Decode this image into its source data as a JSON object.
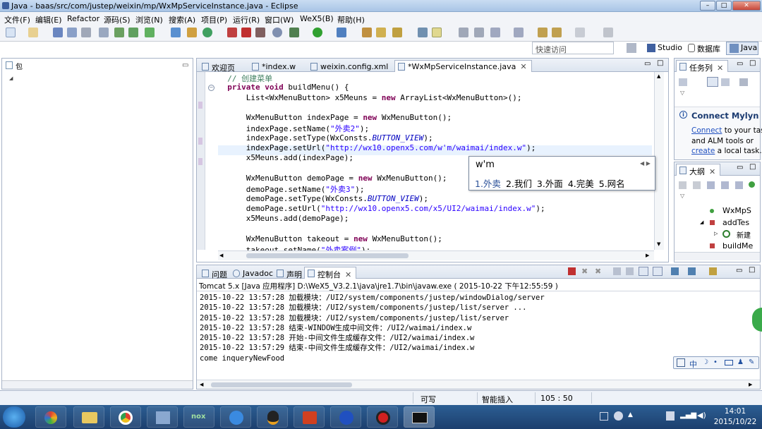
{
  "window": {
    "title": "Java - baas/src/com/justep/weixin/mp/WxMpServiceInstance.java - Eclipse"
  },
  "menu": [
    "文件(F)",
    "编辑(E)",
    "Refactor",
    "源码(S)",
    "浏览(N)",
    "搜索(A)",
    "项目(P)",
    "运行(R)",
    "窗口(W)",
    "WeX5(B)",
    "帮助(H)"
  ],
  "quick_access": {
    "placeholder": "快速访问"
  },
  "perspectives": [
    "Studio",
    "数据库",
    "Java"
  ],
  "left_panel": {
    "label": "包"
  },
  "editor_tabs": [
    "欢迎页",
    "*index.w",
    "weixin.config.xml",
    "*WxMpServiceInstance.java"
  ],
  "code_lines": [
    {
      "parts": [
        [
          "cm",
          "  // 创建菜单"
        ]
      ]
    },
    {
      "parts": [
        [
          "kw",
          "  private void "
        ],
        [
          "n",
          "buildMenu() {"
        ]
      ]
    },
    {
      "parts": [
        [
          "n",
          "      List<WxMenuButton> x5Meuns = "
        ],
        [
          "kw",
          "new "
        ],
        [
          "n",
          "ArrayList<WxMenuButton>();"
        ]
      ]
    },
    {
      "parts": [
        [
          "n",
          ""
        ]
      ]
    },
    {
      "parts": [
        [
          "n",
          "      WxMenuButton indexPage = "
        ],
        [
          "kw",
          "new "
        ],
        [
          "n",
          "WxMenuButton();"
        ]
      ]
    },
    {
      "parts": [
        [
          "n",
          "      indexPage.setName("
        ],
        [
          "str",
          "\"外卖2\""
        ],
        [
          "n",
          ");"
        ]
      ]
    },
    {
      "parts": [
        [
          "n",
          "      indexPage.setType(WxConsts."
        ],
        [
          "it",
          "BUTTON_VIEW"
        ],
        [
          "n",
          ");"
        ]
      ]
    },
    {
      "parts": [
        [
          "n",
          "      indexPage.setUrl("
        ],
        [
          "str",
          "\"http://wx10.openx5.com/w'm/waimai/index.w\""
        ],
        [
          "n",
          ");"
        ]
      ]
    },
    {
      "parts": [
        [
          "n",
          "      x5Meuns.add(indexPage);"
        ]
      ]
    },
    {
      "parts": [
        [
          "n",
          ""
        ]
      ]
    },
    {
      "parts": [
        [
          "n",
          "      WxMenuButton demoPage = "
        ],
        [
          "kw",
          "new "
        ],
        [
          "n",
          "WxMenuButton();"
        ]
      ]
    },
    {
      "parts": [
        [
          "n",
          "      demoPage.setName("
        ],
        [
          "str",
          "\"外卖3\""
        ],
        [
          "n",
          ");"
        ]
      ]
    },
    {
      "parts": [
        [
          "n",
          "      demoPage.setType(WxConsts."
        ],
        [
          "it",
          "BUTTON_VIEW"
        ],
        [
          "n",
          ");"
        ]
      ]
    },
    {
      "parts": [
        [
          "n",
          "      demoPage.setUrl("
        ],
        [
          "str",
          "\"http://wx10.openx5.com/x5/UI2/waimai/index.w\""
        ],
        [
          "n",
          ");"
        ]
      ]
    },
    {
      "parts": [
        [
          "n",
          "      x5Meuns.add(demoPage);"
        ]
      ]
    },
    {
      "parts": [
        [
          "n",
          ""
        ]
      ]
    },
    {
      "parts": [
        [
          "n",
          "      WxMenuButton takeout = "
        ],
        [
          "kw",
          "new "
        ],
        [
          "n",
          "WxMenuButton();"
        ]
      ]
    },
    {
      "parts": [
        [
          "n",
          "      takeout.setName("
        ],
        [
          "str",
          "\"外卖案例\""
        ],
        [
          "n",
          ");"
        ]
      ]
    }
  ],
  "ime_popup": {
    "input": "w'm",
    "candidates": [
      "1.外卖",
      "2.我们",
      "3.外面",
      "4.完美",
      "5.网名"
    ]
  },
  "task_panel": {
    "tab": "任务列",
    "mylyn_title": "Connect Mylyn",
    "mylyn_connect": "Connect",
    "mylyn_text1": " to your tas",
    "mylyn_text2": "and ALM tools or",
    "mylyn_create": "create",
    "mylyn_text3": " a local task."
  },
  "outline_panel": {
    "tab": "大纲",
    "items": [
      "WxMpS",
      "addTes",
      "新建",
      "buildMe"
    ]
  },
  "bottom_tabs": [
    "问题",
    "Javadoc",
    "声明",
    "控制台"
  ],
  "console": {
    "header": "Tomcat 5.x [Java 应用程序] D:\\WeX5_V3.2.1\\java\\jre1.7\\bin\\javaw.exe ( 2015-10-22 下午12:55:59 )",
    "lines": [
      "2015-10-22 13:57:28 加载模块：/UI2/system/components/justep/windowDialog/server",
      "2015-10-22 13:57:28 加载模块：/UI2/system/components/justep/list/server ...",
      "2015-10-22 13:57:28 加载模块：/UI2/system/components/justep/list/server",
      "2015-10-22 13:57:28 结束-WINDOW生成中间文件：/UI2/waimai/index.w",
      "2015-10-22 13:57:28 开始-中间文件生成缓存文件：/UI2/waimai/index.w",
      "2015-10-22 13:57:29 结束-中间文件生成缓存文件：/UI2/waimai/index.w",
      "come inqueryNewFood"
    ]
  },
  "status": {
    "writable": "可写",
    "insert_mode": "智能插入",
    "position": "105 : 50"
  },
  "ime_bar": {
    "label": "中"
  },
  "tray": {
    "time": "14:01",
    "date": "2015/10/22"
  },
  "colors": {
    "keyword": "#7f0055",
    "string": "#2a00ff",
    "constant": "#0000c0",
    "comment": "#3f7f5f",
    "taskbar": "#1c3f6e"
  }
}
